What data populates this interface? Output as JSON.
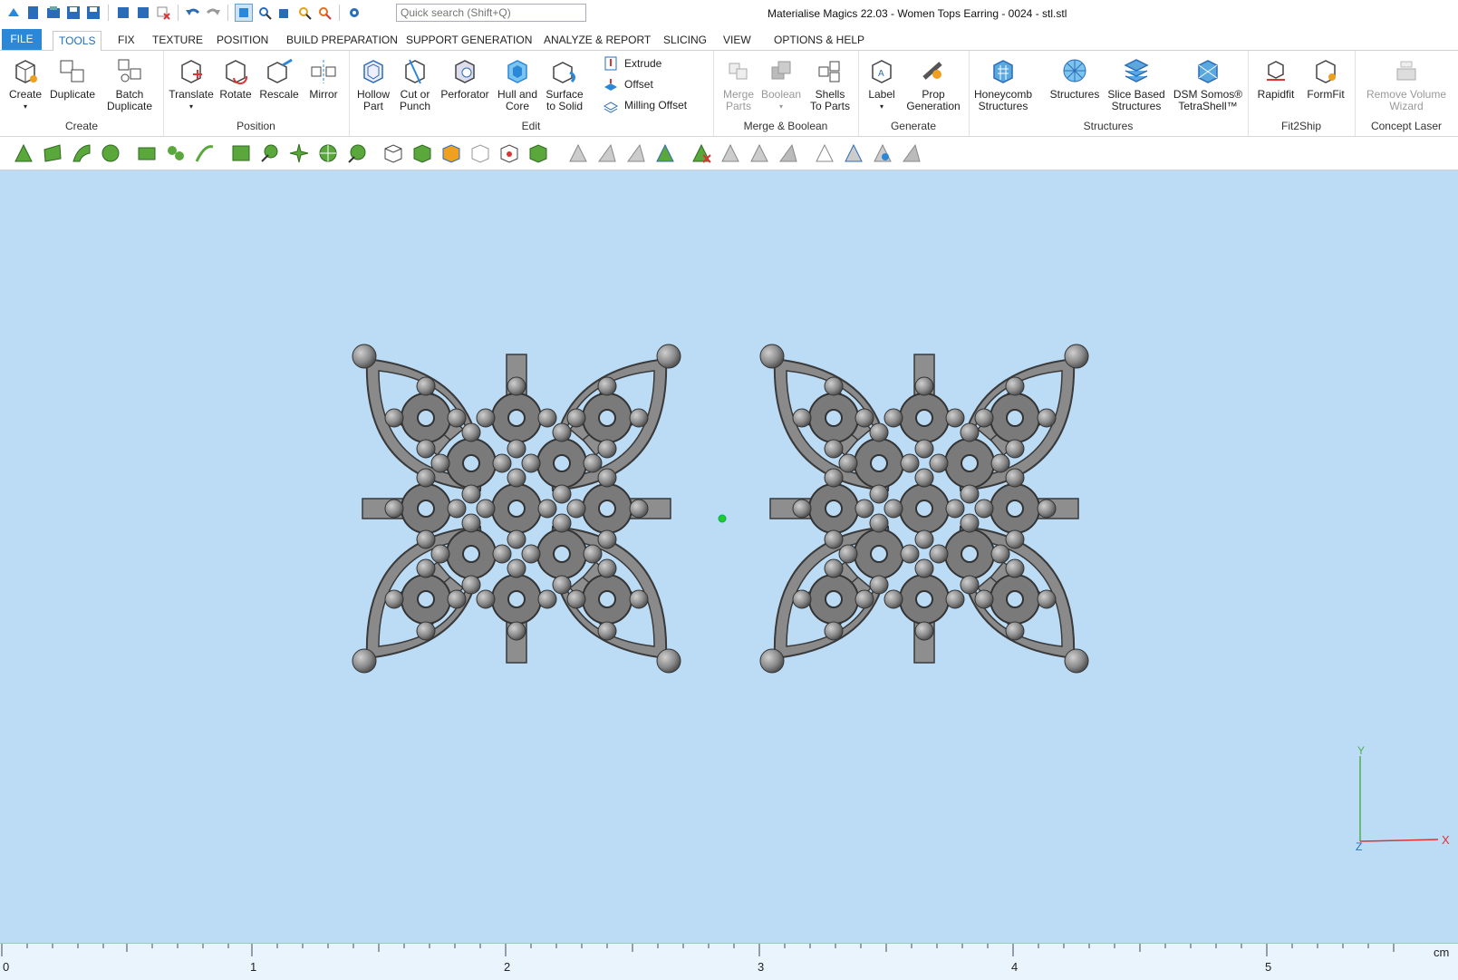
{
  "window": {
    "title": "Materialise Magics 22.03 - Women Tops Earring - 0024 - stl.stl"
  },
  "quick_access": {
    "icons": [
      "app-logo-icon",
      "new-icon",
      "open-icon",
      "save-icon",
      "save-as-icon",
      "import-icon",
      "export-icon",
      "close-part-icon",
      "undo-icon",
      "redo-icon",
      "select-icon",
      "zoom-icon",
      "view-box-icon",
      "find-icon",
      "measure-icon",
      "settings-search-icon"
    ],
    "search_placeholder": "Quick search (Shift+Q)"
  },
  "tabs": [
    "FILE",
    "TOOLS",
    "FIX",
    "TEXTURE",
    "POSITION",
    "BUILD PREPARATION",
    "SUPPORT GENERATION",
    "ANALYZE & REPORT",
    "SLICING",
    "VIEW",
    "OPTIONS & HELP"
  ],
  "active_tab": "TOOLS",
  "ribbon": {
    "groups": [
      {
        "label": "Create",
        "buttons": [
          {
            "label1": "Create",
            "label2": ""
          },
          {
            "label1": "Duplicate",
            "label2": ""
          },
          {
            "label1": "Batch",
            "label2": "Duplicate"
          }
        ]
      },
      {
        "label": "Position",
        "buttons": [
          {
            "label1": "Translate",
            "label2": ""
          },
          {
            "label1": "Rotate",
            "label2": ""
          },
          {
            "label1": "Rescale",
            "label2": ""
          },
          {
            "label1": "Mirror",
            "label2": ""
          }
        ]
      },
      {
        "label": "Edit",
        "buttons": [
          {
            "label1": "Hollow",
            "label2": "Part"
          },
          {
            "label1": "Cut or",
            "label2": "Punch"
          },
          {
            "label1": "Perforator",
            "label2": ""
          },
          {
            "label1": "Hull and",
            "label2": "Core"
          },
          {
            "label1": "Surface",
            "label2": "to Solid"
          }
        ],
        "small_buttons": [
          "Extrude",
          "Offset",
          "Milling Offset"
        ]
      },
      {
        "label": "Merge & Boolean",
        "buttons": [
          {
            "label1": "Merge",
            "label2": "Parts"
          },
          {
            "label1": "Boolean",
            "label2": ""
          },
          {
            "label1": "Shells",
            "label2": "To Parts"
          }
        ]
      },
      {
        "label": "Generate",
        "buttons": [
          {
            "label1": "Label",
            "label2": ""
          },
          {
            "label1": "Prop",
            "label2": "Generation"
          }
        ]
      },
      {
        "label": "Structures",
        "buttons": [
          {
            "label1": "Honeycomb",
            "label2": "Structures"
          },
          {
            "label1": "Structures",
            "label2": ""
          },
          {
            "label1": "Slice Based",
            "label2": "Structures"
          },
          {
            "label1": "DSM Somos®",
            "label2": "TetraShell™"
          }
        ]
      },
      {
        "label": "Fit2Ship",
        "buttons": [
          {
            "label1": "Rapidfit",
            "label2": ""
          },
          {
            "label1": "FormFit",
            "label2": ""
          }
        ]
      },
      {
        "label": "Concept Laser",
        "buttons": [
          {
            "label1": "Remove Volume",
            "label2": "Wizard"
          }
        ]
      }
    ]
  },
  "viewport": {
    "parts": [
      "earring-part-left",
      "earring-part-right"
    ],
    "axes": {
      "y": "Y",
      "x": "X",
      "z": "Z"
    }
  },
  "ruler": {
    "ticks": [
      "0",
      "1",
      "2",
      "3",
      "4",
      "5"
    ],
    "unit": "cm"
  },
  "colors": {
    "viewport_bg": "#bcdcf6",
    "file_tab": "#2b88d8",
    "accent": "#1f6fb8",
    "part": "#8a8a8a",
    "toolbar_green": "#5aa83c"
  }
}
